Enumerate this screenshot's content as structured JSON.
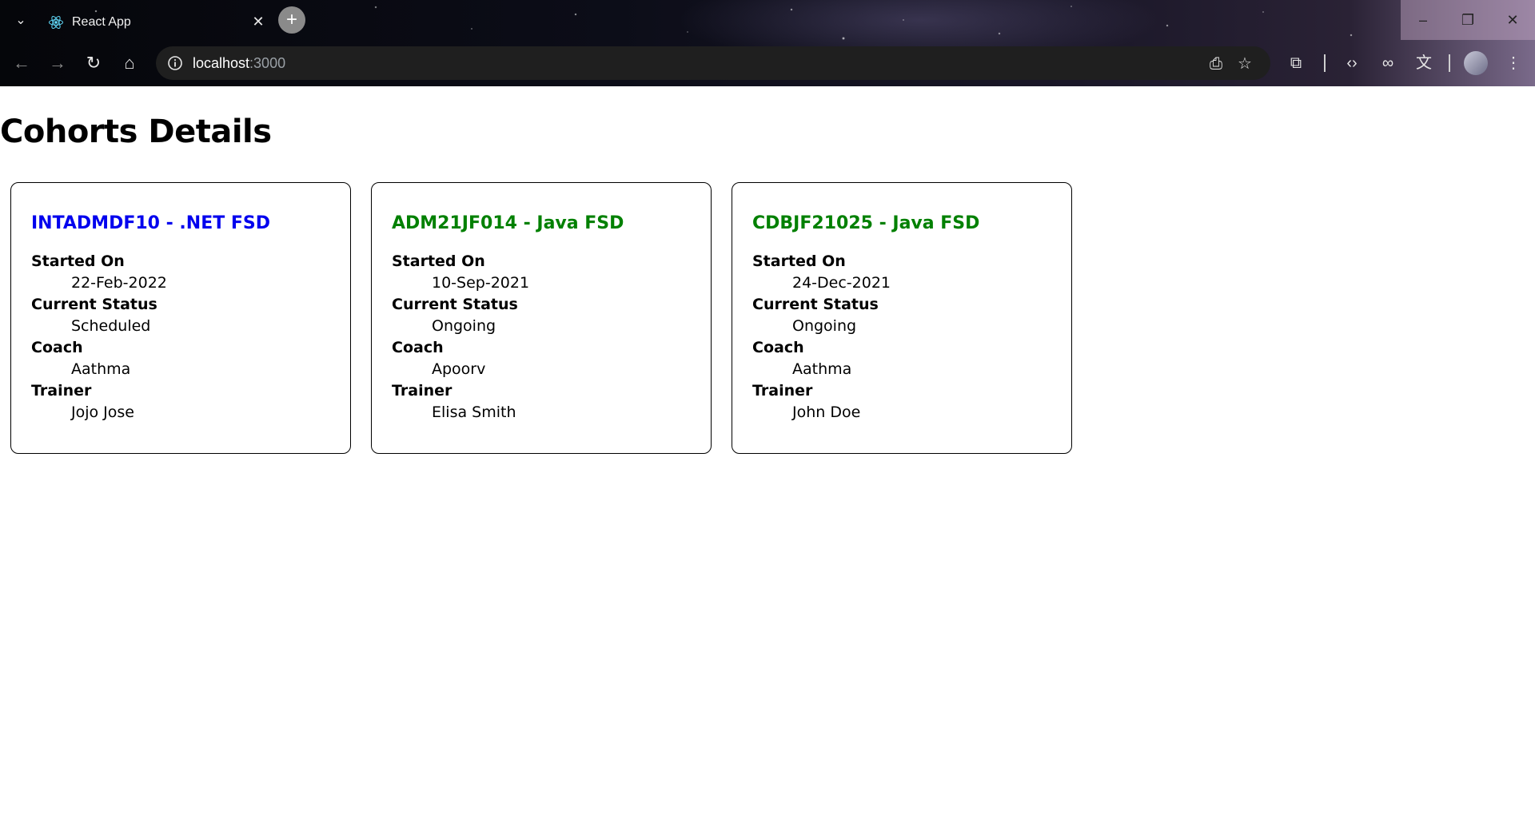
{
  "browser": {
    "tab_title": "React App",
    "url_host": "localhost",
    "url_port": ":3000",
    "icons": [
      "tab-search-icon",
      "react-favicon-icon",
      "close-icon",
      "plus-icon",
      "back-icon",
      "forward-icon",
      "reload-icon",
      "home-icon",
      "info-icon",
      "install-icon",
      "star-icon",
      "extensions-icon",
      "code-icon",
      "link-icon",
      "translate-icon",
      "menu-icon",
      "minimize-icon",
      "restore-icon",
      "window-close-icon"
    ]
  },
  "page": {
    "title": "Cohorts Details",
    "cohorts": [
      {
        "name": "INTADMDF10 - .NET FSD",
        "color": "#0000ee",
        "started_label": "Started On",
        "started": "22-Feb-2022",
        "status_label": "Current Status",
        "status": "Scheduled",
        "coach_label": "Coach",
        "coach": "Aathma",
        "trainer_label": "Trainer",
        "trainer": "Jojo Jose"
      },
      {
        "name": "ADM21JF014 - Java FSD",
        "color": "#008000",
        "started_label": "Started On",
        "started": "10-Sep-2021",
        "status_label": "Current Status",
        "status": "Ongoing",
        "coach_label": "Coach",
        "coach": "Apoorv",
        "trainer_label": "Trainer",
        "trainer": "Elisa Smith"
      },
      {
        "name": "CDBJF21025 - Java FSD",
        "color": "#008000",
        "started_label": "Started On",
        "started": "24-Dec-2021",
        "status_label": "Current Status",
        "status": "Ongoing",
        "coach_label": "Coach",
        "coach": "Aathma",
        "trainer_label": "Trainer",
        "trainer": "John Doe"
      }
    ]
  }
}
